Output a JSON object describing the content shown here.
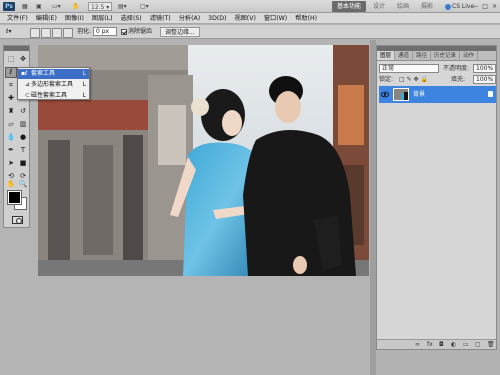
{
  "app": {
    "logo": "Ps"
  },
  "appbar": {
    "zoom_value": "12.5",
    "workspace_tabs": [
      "基本功能",
      "设计",
      "绘画",
      "摄影"
    ],
    "more": "»",
    "cslive": "CS Live",
    "win_min": "−",
    "win_max": "□",
    "win_close": "×"
  },
  "menubar": {
    "items": [
      "文件(F)",
      "编辑(E)",
      "图像(I)",
      "图层(L)",
      "选择(S)",
      "滤镜(T)",
      "分析(A)",
      "3D(D)",
      "视图(V)",
      "窗口(W)",
      "帮助(H)"
    ]
  },
  "options": {
    "feather_label": "羽化:",
    "feather_value": "0 px",
    "antialias_label": "消除锯齿",
    "refine_edge": "调整边缘..."
  },
  "flyout": {
    "items": [
      {
        "label": "套索工具",
        "key": "L",
        "active": true
      },
      {
        "label": "多边形套索工具",
        "key": "L",
        "active": false
      },
      {
        "label": "磁性套索工具",
        "key": "L",
        "active": false
      }
    ]
  },
  "layers_panel": {
    "tabs": [
      "图层",
      "通道",
      "路径",
      "历史记录",
      "动作"
    ],
    "blend_mode": "正常",
    "opacity_label": "不透明度:",
    "opacity_value": "100%",
    "lock_label": "锁定:",
    "fill_label": "填充:",
    "fill_value": "100%",
    "layer_name": "背景",
    "footer_icons": [
      "link-icon",
      "fx-icon",
      "mask-icon",
      "adjustment-icon",
      "folder-icon",
      "new-layer-icon",
      "trash-icon"
    ]
  },
  "colors": {
    "accent": "#3d84e0",
    "foreground": "#000000",
    "background": "#ffffff"
  }
}
